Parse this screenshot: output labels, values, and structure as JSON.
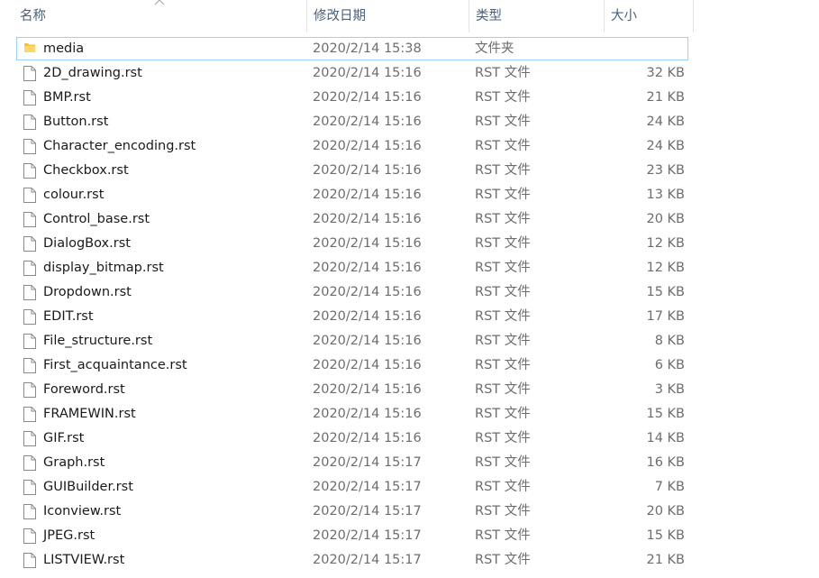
{
  "columns": {
    "name": "名称",
    "date": "修改日期",
    "type": "类型",
    "size": "大小"
  },
  "files": [
    {
      "name": "media",
      "date": "2020/2/14 15:38",
      "type": "文件夹",
      "size": "",
      "icon": "folder-icon"
    },
    {
      "name": "2D_drawing.rst",
      "date": "2020/2/14 15:16",
      "type": "RST 文件",
      "size": "32 KB",
      "icon": "file-icon"
    },
    {
      "name": "BMP.rst",
      "date": "2020/2/14 15:16",
      "type": "RST 文件",
      "size": "21 KB",
      "icon": "file-icon"
    },
    {
      "name": "Button.rst",
      "date": "2020/2/14 15:16",
      "type": "RST 文件",
      "size": "24 KB",
      "icon": "file-icon"
    },
    {
      "name": "Character_encoding.rst",
      "date": "2020/2/14 15:16",
      "type": "RST 文件",
      "size": "24 KB",
      "icon": "file-icon"
    },
    {
      "name": "Checkbox.rst",
      "date": "2020/2/14 15:16",
      "type": "RST 文件",
      "size": "23 KB",
      "icon": "file-icon"
    },
    {
      "name": "colour.rst",
      "date": "2020/2/14 15:16",
      "type": "RST 文件",
      "size": "13 KB",
      "icon": "file-icon"
    },
    {
      "name": "Control_base.rst",
      "date": "2020/2/14 15:16",
      "type": "RST 文件",
      "size": "20 KB",
      "icon": "file-icon"
    },
    {
      "name": "DialogBox.rst",
      "date": "2020/2/14 15:16",
      "type": "RST 文件",
      "size": "12 KB",
      "icon": "file-icon"
    },
    {
      "name": "display_bitmap.rst",
      "date": "2020/2/14 15:16",
      "type": "RST 文件",
      "size": "12 KB",
      "icon": "file-icon"
    },
    {
      "name": "Dropdown.rst",
      "date": "2020/2/14 15:16",
      "type": "RST 文件",
      "size": "15 KB",
      "icon": "file-icon"
    },
    {
      "name": "EDIT.rst",
      "date": "2020/2/14 15:16",
      "type": "RST 文件",
      "size": "17 KB",
      "icon": "file-icon"
    },
    {
      "name": "File_structure.rst",
      "date": "2020/2/14 15:16",
      "type": "RST 文件",
      "size": "8 KB",
      "icon": "file-icon"
    },
    {
      "name": "First_acquaintance.rst",
      "date": "2020/2/14 15:16",
      "type": "RST 文件",
      "size": "6 KB",
      "icon": "file-icon"
    },
    {
      "name": "Foreword.rst",
      "date": "2020/2/14 15:16",
      "type": "RST 文件",
      "size": "3 KB",
      "icon": "file-icon"
    },
    {
      "name": "FRAMEWIN.rst",
      "date": "2020/2/14 15:16",
      "type": "RST 文件",
      "size": "15 KB",
      "icon": "file-icon"
    },
    {
      "name": "GIF.rst",
      "date": "2020/2/14 15:16",
      "type": "RST 文件",
      "size": "14 KB",
      "icon": "file-icon"
    },
    {
      "name": "Graph.rst",
      "date": "2020/2/14 15:17",
      "type": "RST 文件",
      "size": "16 KB",
      "icon": "file-icon"
    },
    {
      "name": "GUIBuilder.rst",
      "date": "2020/2/14 15:17",
      "type": "RST 文件",
      "size": "7 KB",
      "icon": "file-icon"
    },
    {
      "name": "Iconview.rst",
      "date": "2020/2/14 15:17",
      "type": "RST 文件",
      "size": "20 KB",
      "icon": "file-icon"
    },
    {
      "name": "JPEG.rst",
      "date": "2020/2/14 15:17",
      "type": "RST 文件",
      "size": "15 KB",
      "icon": "file-icon"
    },
    {
      "name": "LISTVIEW.rst",
      "date": "2020/2/14 15:17",
      "type": "RST 文件",
      "size": "21 KB",
      "icon": "file-icon"
    }
  ],
  "colors": {
    "header_text": "#4c607a",
    "focus_border": "#99d1ff",
    "folder": "#f4c242"
  }
}
